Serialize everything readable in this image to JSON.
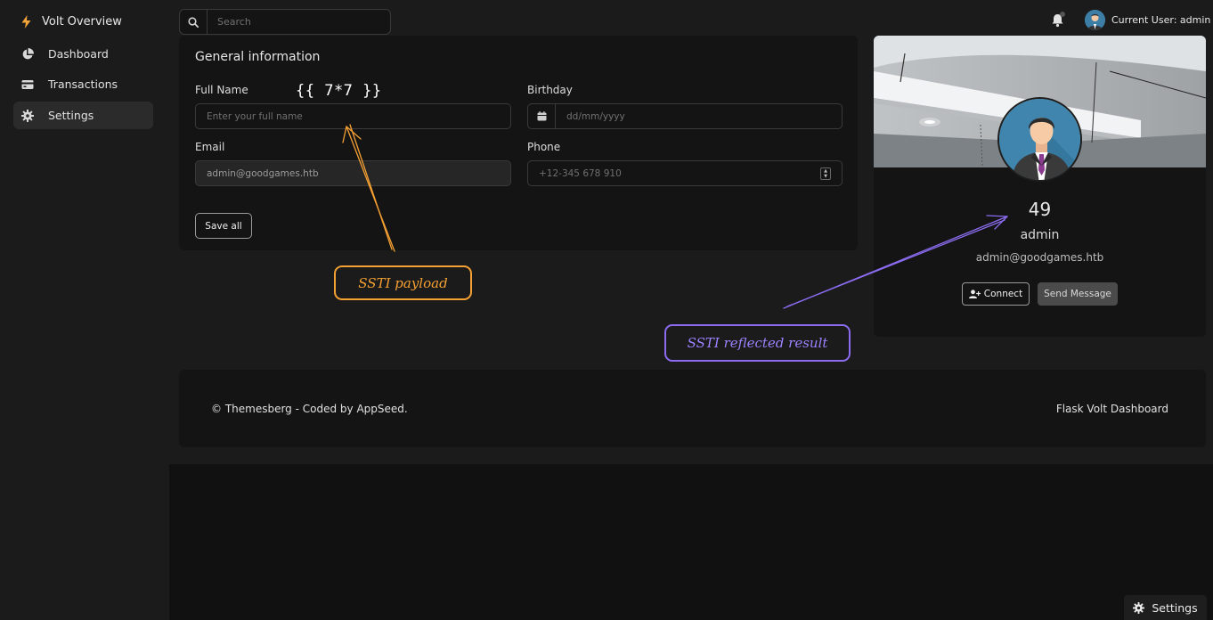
{
  "sidebar": {
    "brand": "Volt Overview",
    "items": [
      {
        "label": "Dashboard",
        "icon": "pie-chart-icon"
      },
      {
        "label": "Transactions",
        "icon": "credit-card-icon"
      },
      {
        "label": "Settings",
        "icon": "gear-icon",
        "active": true
      }
    ]
  },
  "topbar": {
    "search_placeholder": "Search",
    "current_user": "Current User: admin"
  },
  "general_info": {
    "title": "General information",
    "full_name_label": "Full Name",
    "full_name_placeholder": "Enter your full name",
    "full_name_overlay": "{{ 7*7 }}",
    "birthday_label": "Birthday",
    "birthday_placeholder": "dd/mm/yyyy",
    "email_label": "Email",
    "email_value": "admin@goodgames.htb",
    "phone_label": "Phone",
    "phone_placeholder": "+12-345 678 910",
    "save_label": "Save all"
  },
  "profile": {
    "name": "49",
    "username": "admin",
    "email": "admin@goodgames.htb",
    "connect_label": "Connect",
    "message_label": "Send Message"
  },
  "annotations": {
    "payload": "SSTI payload",
    "result": "SSTI reflected result",
    "payload_color": "#f5a033",
    "result_color": "#8b6cf0"
  },
  "footer": {
    "left": "© Themesberg - Coded by AppSeed.",
    "right": "Flask Volt Dashboard"
  },
  "floating_settings": "Settings"
}
